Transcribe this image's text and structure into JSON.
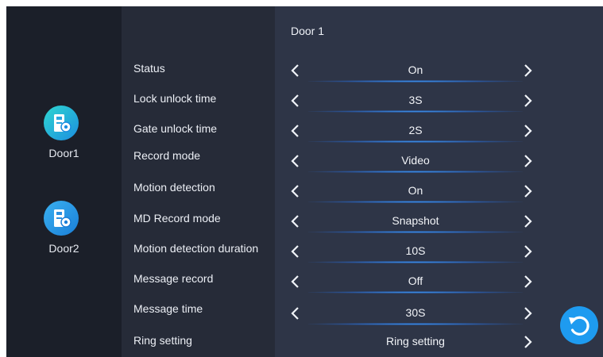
{
  "sidebar": {
    "doors": [
      {
        "label": "Door1",
        "icon": "door-settings-icon"
      },
      {
        "label": "Door2",
        "icon": "door-settings-icon"
      }
    ]
  },
  "panel": {
    "title": "Door 1",
    "settings": [
      {
        "label": "Status",
        "value": "On"
      },
      {
        "label": "Lock unlock time",
        "value": "3S"
      },
      {
        "label": "Gate unlock time",
        "value": "2S"
      },
      {
        "label": "Record mode",
        "value": "Video"
      },
      {
        "label": "Motion detection",
        "value": "On"
      },
      {
        "label": "MD Record mode",
        "value": "Snapshot"
      },
      {
        "label": "Motion detection duration",
        "value": "10S"
      },
      {
        "label": "Message record",
        "value": "Off"
      },
      {
        "label": "Message time",
        "value": "30S"
      },
      {
        "label": "Ring setting",
        "value": "Ring setting"
      }
    ]
  },
  "colors": {
    "accent": "#1e9bf0",
    "icon_gradient_start": "#2fd0d6",
    "icon_gradient_end": "#1a8fe0"
  },
  "icons": {
    "prev": "chevron-left-icon",
    "next": "chevron-right-icon",
    "refresh": "refresh-icon"
  }
}
